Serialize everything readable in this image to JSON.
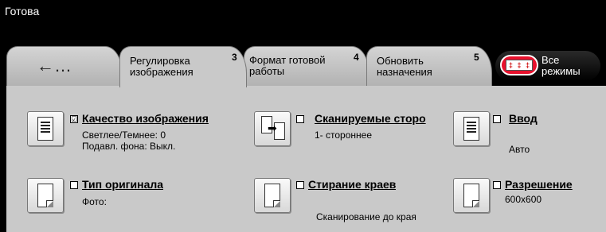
{
  "status": {
    "text": "Готова"
  },
  "tabs": {
    "back": {
      "arrow": "←…"
    },
    "items": [
      {
        "label": "Регулировка изображения",
        "number": "3"
      },
      {
        "label": "Формат готовой работы",
        "number": "4"
      },
      {
        "label": "Обновить назначения",
        "number": "5"
      }
    ],
    "all_modes": {
      "label": "Все режимы"
    }
  },
  "features": {
    "image_quality": {
      "checked": "☑",
      "title": "Качество изображения",
      "line1": "Светлее/Темнее: 0",
      "line2": "Подавл. фона: Выкл."
    },
    "scanned_sides": {
      "checked": "",
      "title": "Сканируемые сторо",
      "value": "1- стороннее"
    },
    "input": {
      "checked": "",
      "title": "Ввод",
      "value": "Авто"
    },
    "original_type": {
      "checked": "",
      "title": "Тип оригинала",
      "value": "Фото:"
    },
    "edge_erase": {
      "checked": "",
      "title": "Стирание краев",
      "value": "Сканирование до края"
    },
    "resolution": {
      "checked": "",
      "title": "Разрешение",
      "value": "600x600"
    }
  }
}
